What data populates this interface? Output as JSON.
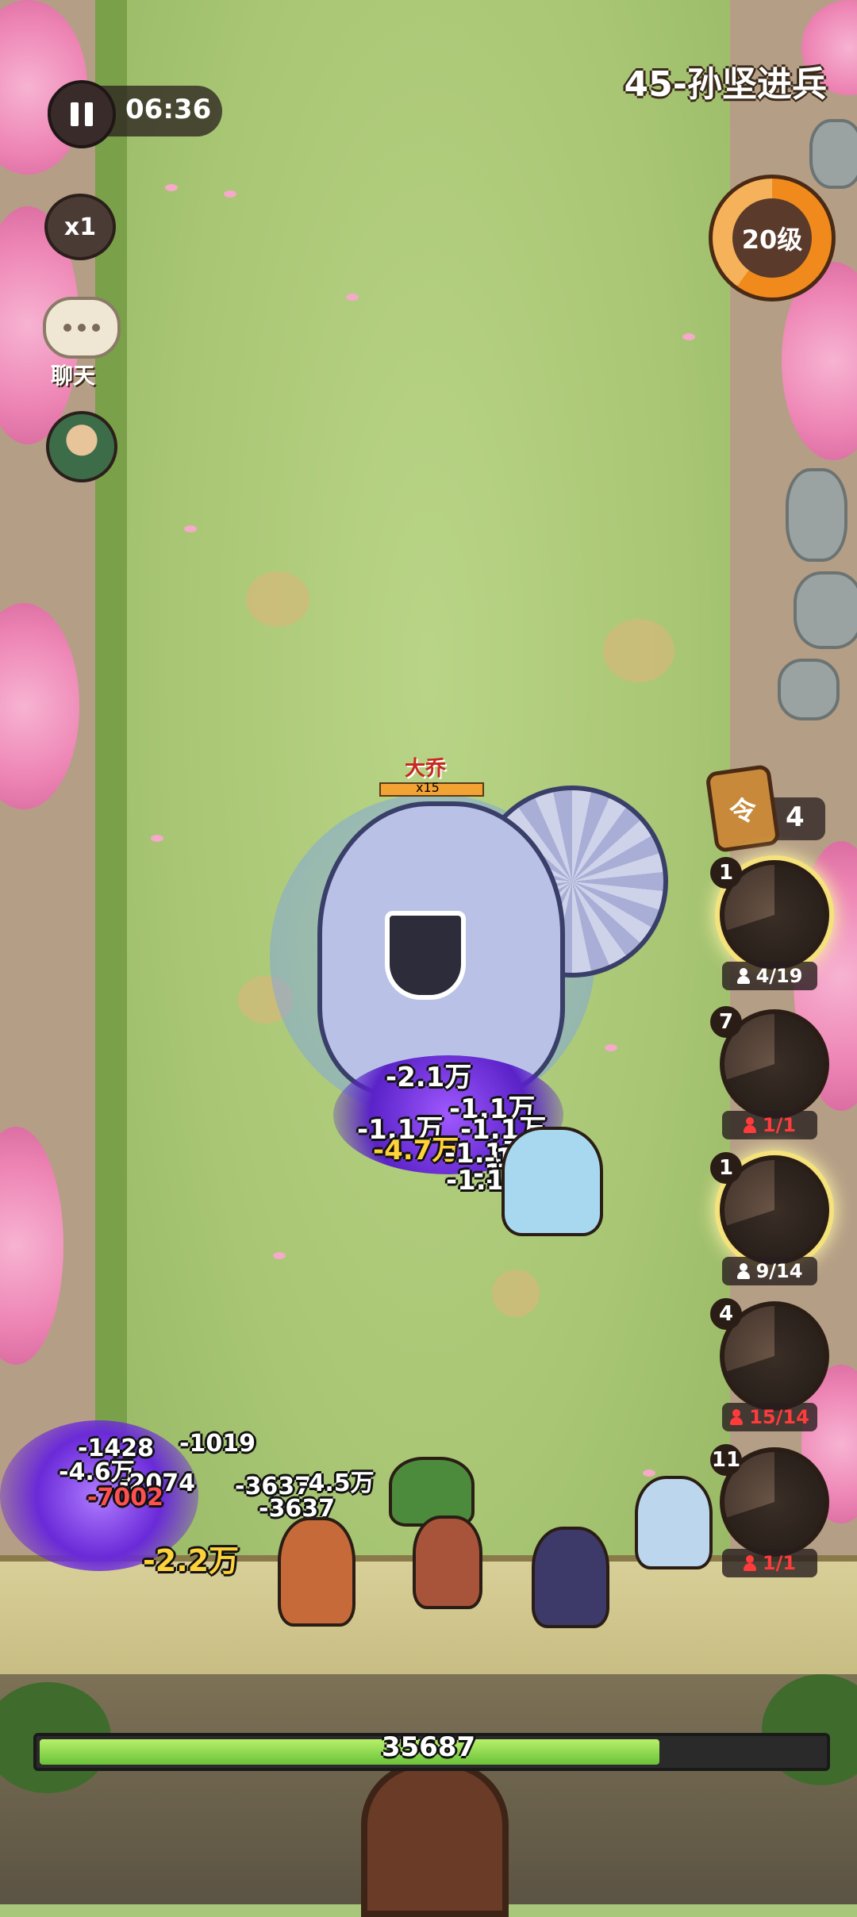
{
  "hud": {
    "timer": "06:36",
    "level_title": "45-孙坚进兵",
    "player_level": "20级",
    "speed": "x1",
    "chat_label": "聊天"
  },
  "boss": {
    "name": "大乔",
    "multiplier": "x15"
  },
  "damage_numbers": {
    "boss": [
      "-2.1万",
      "-1.1万",
      "-1.1万",
      "-1.1万",
      "-4.7万",
      "-1.1万",
      "-1.1万",
      "-1.1万",
      "-1.1万"
    ],
    "left": [
      "-1428",
      "-1019",
      "-4.6万",
      "-2074",
      "-7002",
      "-3637",
      "-3637",
      "-4.5万",
      "-2.2万"
    ]
  },
  "units_panel": {
    "command_tokens": "4",
    "units": [
      {
        "level": "1",
        "count": "4/19",
        "alert": false,
        "ready": true
      },
      {
        "level": "7",
        "count": "1/1",
        "alert": true,
        "ready": false
      },
      {
        "level": "1",
        "count": "9/14",
        "alert": false,
        "ready": true
      },
      {
        "level": "4",
        "count": "15/14",
        "alert": true,
        "ready": false
      },
      {
        "level": "11",
        "count": "1/1",
        "alert": true,
        "ready": false
      }
    ]
  },
  "wall": {
    "hp": "35687",
    "hp_fraction": 0.79
  },
  "colors": {
    "alert": "#ff3b3b",
    "damage_yellow": "#ffd23a",
    "hp_green": "#8ed84e",
    "level_ring": "#f08a1d"
  },
  "icons": [
    "pause-icon",
    "speed-icon",
    "chat-icon",
    "hero-avatar",
    "command-token-icon",
    "person-icon",
    "shield-icon"
  ]
}
